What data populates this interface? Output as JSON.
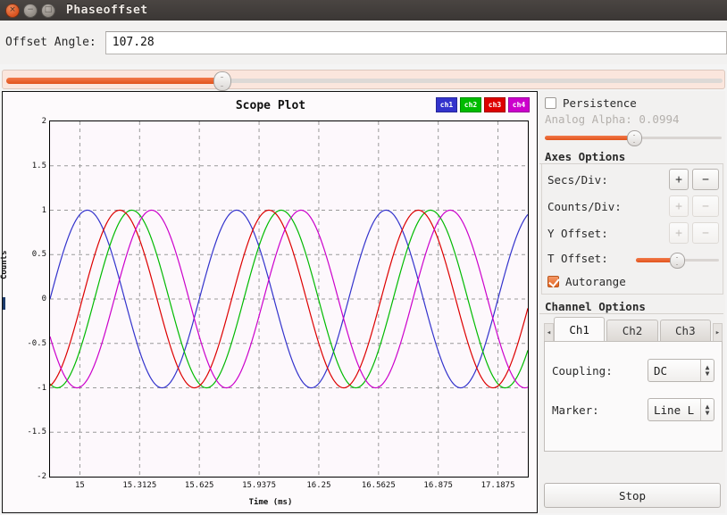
{
  "window": {
    "title": "Phaseoffset",
    "controls": [
      {
        "name": "close",
        "glyph": "×"
      },
      {
        "name": "minimize",
        "glyph": "−"
      },
      {
        "name": "maximize",
        "glyph": "□"
      }
    ]
  },
  "top": {
    "offset_angle_label": "Offset Angle:",
    "offset_angle_value": "107.28",
    "slider_percent": 30
  },
  "plot": {
    "title": "Scope Plot",
    "legend": [
      {
        "label": "ch1",
        "color": "#3333cc"
      },
      {
        "label": "ch2",
        "color": "#00bb00"
      },
      {
        "label": "ch3",
        "color": "#dd0000"
      },
      {
        "label": "ch4",
        "color": "#cc00cc"
      }
    ]
  },
  "chart_data": {
    "type": "line",
    "title": "Scope Plot",
    "xlabel": "Time (ms)",
    "ylabel": "Counts",
    "xlim": [
      14.84375,
      17.34375
    ],
    "ylim": [
      -2,
      2
    ],
    "grid": true,
    "legend_position": "top-right",
    "xticks": [
      "15",
      "15.3125",
      "15.625",
      "15.9375",
      "16.25",
      "16.5625",
      "16.875",
      "17.1875"
    ],
    "xtick_values": [
      15,
      15.3125,
      15.625,
      15.9375,
      16.25,
      16.5625,
      16.875,
      17.1875
    ],
    "yticks": [
      "2",
      "1.5",
      "1",
      "0.5",
      "0",
      "-0.5",
      "-1",
      "-1.5",
      "-2"
    ],
    "ytick_values": [
      2,
      1.5,
      1,
      0.5,
      0,
      -0.5,
      -1,
      -1.5,
      -2
    ],
    "waveform": {
      "shape": "sine",
      "amplitude": 1,
      "offset": 0,
      "period_ms": 0.78125,
      "frequency_khz": 1.28
    },
    "series": [
      {
        "name": "ch1",
        "color": "#3333cc",
        "phase_deg": 0
      },
      {
        "name": "ch2",
        "color": "#00bb00",
        "phase_deg": -107.28
      },
      {
        "name": "ch3",
        "color": "#dd0000",
        "phase_deg": -78
      },
      {
        "name": "ch4",
        "color": "#cc00cc",
        "phase_deg": -155
      }
    ]
  },
  "side": {
    "persistence_label": "Persistence",
    "persistence_checked": false,
    "analog_alpha_label": "Analog Alpha:",
    "analog_alpha_value": "0.0994",
    "analog_alpha_percent": 50,
    "axes_group_title": "Axes Options",
    "axes_rows": [
      {
        "label": "Secs/Div:",
        "plus": "+",
        "minus": "−",
        "enabled": true
      },
      {
        "label": "Counts/Div:",
        "plus": "+",
        "minus": "−",
        "enabled": false
      },
      {
        "label": "Y Offset:",
        "plus": "+",
        "minus": "−",
        "enabled": false
      }
    ],
    "t_offset_label": "T Offset:",
    "t_offset_percent": 48,
    "autorange_label": "Autorange",
    "autorange_checked": true,
    "channel_group_title": "Channel Options",
    "tab_prev": "◂",
    "tab_next": "▸",
    "tabs": [
      {
        "label": "Ch1",
        "active": true
      },
      {
        "label": "Ch2",
        "active": false
      },
      {
        "label": "Ch3",
        "active": false
      }
    ],
    "coupling_label": "Coupling:",
    "coupling_value": "DC",
    "marker_label": "Marker:",
    "marker_value": "Line L",
    "stop_label": "Stop"
  }
}
